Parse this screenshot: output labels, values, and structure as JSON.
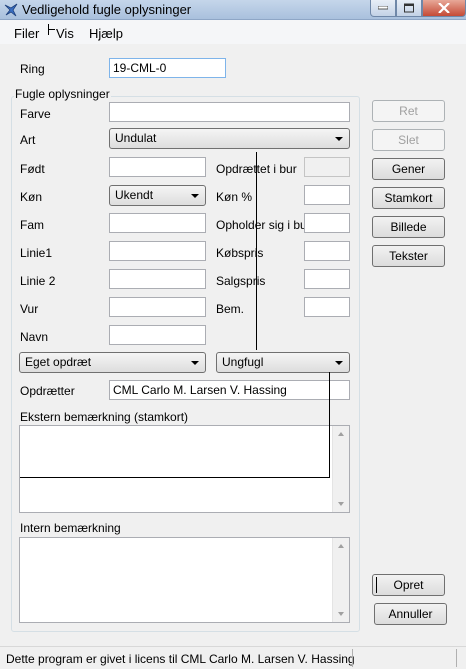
{
  "window": {
    "title": "Vedligehold fugle oplysninger"
  },
  "menu": {
    "items": [
      "Filer",
      "Vis",
      "Hjælp"
    ]
  },
  "ring": {
    "label": "Ring",
    "value": "19-CML-0"
  },
  "group": {
    "title": "Fugle oplysninger"
  },
  "fields": {
    "farve": {
      "label": "Farve",
      "value": ""
    },
    "art": {
      "label": "Art",
      "value": "Undulat"
    },
    "fodt": {
      "label": "Født",
      "value": ""
    },
    "kon": {
      "label": "Køn",
      "value": "Ukendt"
    },
    "fam": {
      "label": "Fam",
      "value": ""
    },
    "linie1": {
      "label": "Linie1",
      "value": ""
    },
    "linie2": {
      "label": "Linie 2",
      "value": ""
    },
    "vur": {
      "label": "Vur",
      "value": ""
    },
    "navn": {
      "label": "Navn",
      "value": ""
    },
    "opdraettet_i_bur": {
      "label": "Opdrættet i bur",
      "value": ""
    },
    "kon_pct": {
      "label": "Køn %",
      "value": ""
    },
    "opholder_sig_i_bur": {
      "label": "Opholder sig i bur",
      "value": ""
    },
    "kobspris": {
      "label": "Købspris",
      "value": ""
    },
    "salgspris": {
      "label": "Salgspris",
      "value": ""
    },
    "bem": {
      "label": "Bem.",
      "value": ""
    },
    "origin": {
      "value": "Eget opdræt"
    },
    "age": {
      "value": "Ungfugl"
    },
    "opdraetter": {
      "label": "Opdrætter",
      "value": "CML Carlo M. Larsen V. Hassing"
    },
    "ekstern": {
      "label": "Ekstern bemærkning (stamkort)",
      "value": ""
    },
    "intern": {
      "label": "Intern bemærkning",
      "value": ""
    }
  },
  "buttons": {
    "ret": "Ret",
    "slet": "Slet",
    "gener": "Gener",
    "stamkort": "Stamkort",
    "billede": "Billede",
    "tekster": "Tekster",
    "opret": "Opret",
    "annuller": "Annuller"
  },
  "status": {
    "text": "Dette program er givet i licens til CML Carlo M. Larsen V. Hassing"
  },
  "icons": {
    "app": "bird-icon",
    "minimize": "minimize-icon",
    "maximize": "maximize-icon",
    "close": "close-icon"
  }
}
